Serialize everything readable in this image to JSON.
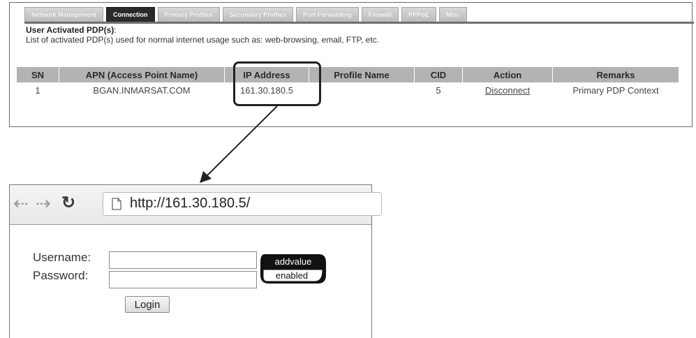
{
  "tabs": [
    {
      "label": "Network Management",
      "active": false
    },
    {
      "label": "Connection",
      "active": true
    },
    {
      "label": "Primary Profiles",
      "active": false
    },
    {
      "label": "Secondary Profiles",
      "active": false
    },
    {
      "label": "Port Forwarding",
      "active": false
    },
    {
      "label": "Firewall",
      "active": false
    },
    {
      "label": "PPPoE",
      "active": false
    },
    {
      "label": "Misc",
      "active": false
    }
  ],
  "section": {
    "title": "User Activated PDP(s)",
    "title_suffix": ":",
    "description": "List of activated PDP(s) used for normal internet usage such as: web-browsing, email, FTP, etc."
  },
  "table": {
    "columns": [
      "SN",
      "APN (Access Point Name)",
      "IP Address",
      "Profile Name",
      "CID",
      "Action",
      "Remarks"
    ],
    "rows": [
      {
        "sn": "1",
        "apn": "BGAN.INMARSAT.COM",
        "ip": "161.30.180.5",
        "profile": "",
        "cid": "5",
        "action": "Disconnect",
        "remarks": "Primary PDP Context"
      }
    ]
  },
  "browser": {
    "back_icon": "back-arrow-icon",
    "forward_icon": "forward-arrow-icon",
    "reload_icon": "reload-icon",
    "url": "http://161.30.180.5/"
  },
  "login": {
    "username_label": "Username:",
    "password_label": "Password:",
    "username_value": "",
    "password_value": "",
    "button_label": "Login"
  },
  "badge": {
    "line1": "addvalue",
    "line2": "enabled"
  },
  "colors": {
    "active_tab": "#2a2a2a",
    "tab": "#c8c8c8",
    "header_row": "#b3b3b3",
    "highlight": "#222222"
  }
}
